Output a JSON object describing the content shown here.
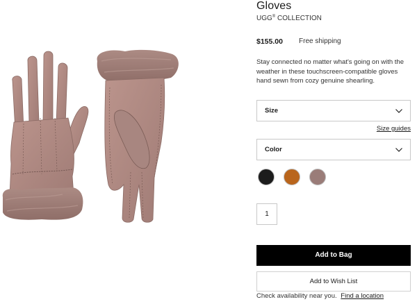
{
  "product": {
    "title": "Gloves",
    "brand": "UGG",
    "brand_mark": "®",
    "brand_suffix": "COLLECTION",
    "price": "$155.00",
    "shipping": "Free shipping",
    "description": "Stay connected no matter what's going on with the weather in these touchscreen-compatible gloves hand sewn from cozy genuine shearling.",
    "image_alt": "gloves-product-image"
  },
  "size_select": {
    "label": "Size",
    "icon": "chevron-down-icon"
  },
  "size_guides_link": "Size guides",
  "color_select": {
    "label": "Color",
    "icon": "chevron-down-icon"
  },
  "swatches": [
    {
      "name": "black",
      "color": "#1c1c1c"
    },
    {
      "name": "chestnut",
      "color": "#b9651c"
    },
    {
      "name": "taupe",
      "color": "#9a7c78"
    }
  ],
  "quantity": "1",
  "add_to_bag": "Add to Bag",
  "add_to_wish_list": "Add to Wish List",
  "availability": {
    "text": "Check availability near you.",
    "link": "Find a location"
  },
  "colors": {
    "glove_suede": "#b48c84",
    "glove_shadow": "#95706a",
    "glove_fur": "#a17f78",
    "button_black": "#000000"
  }
}
